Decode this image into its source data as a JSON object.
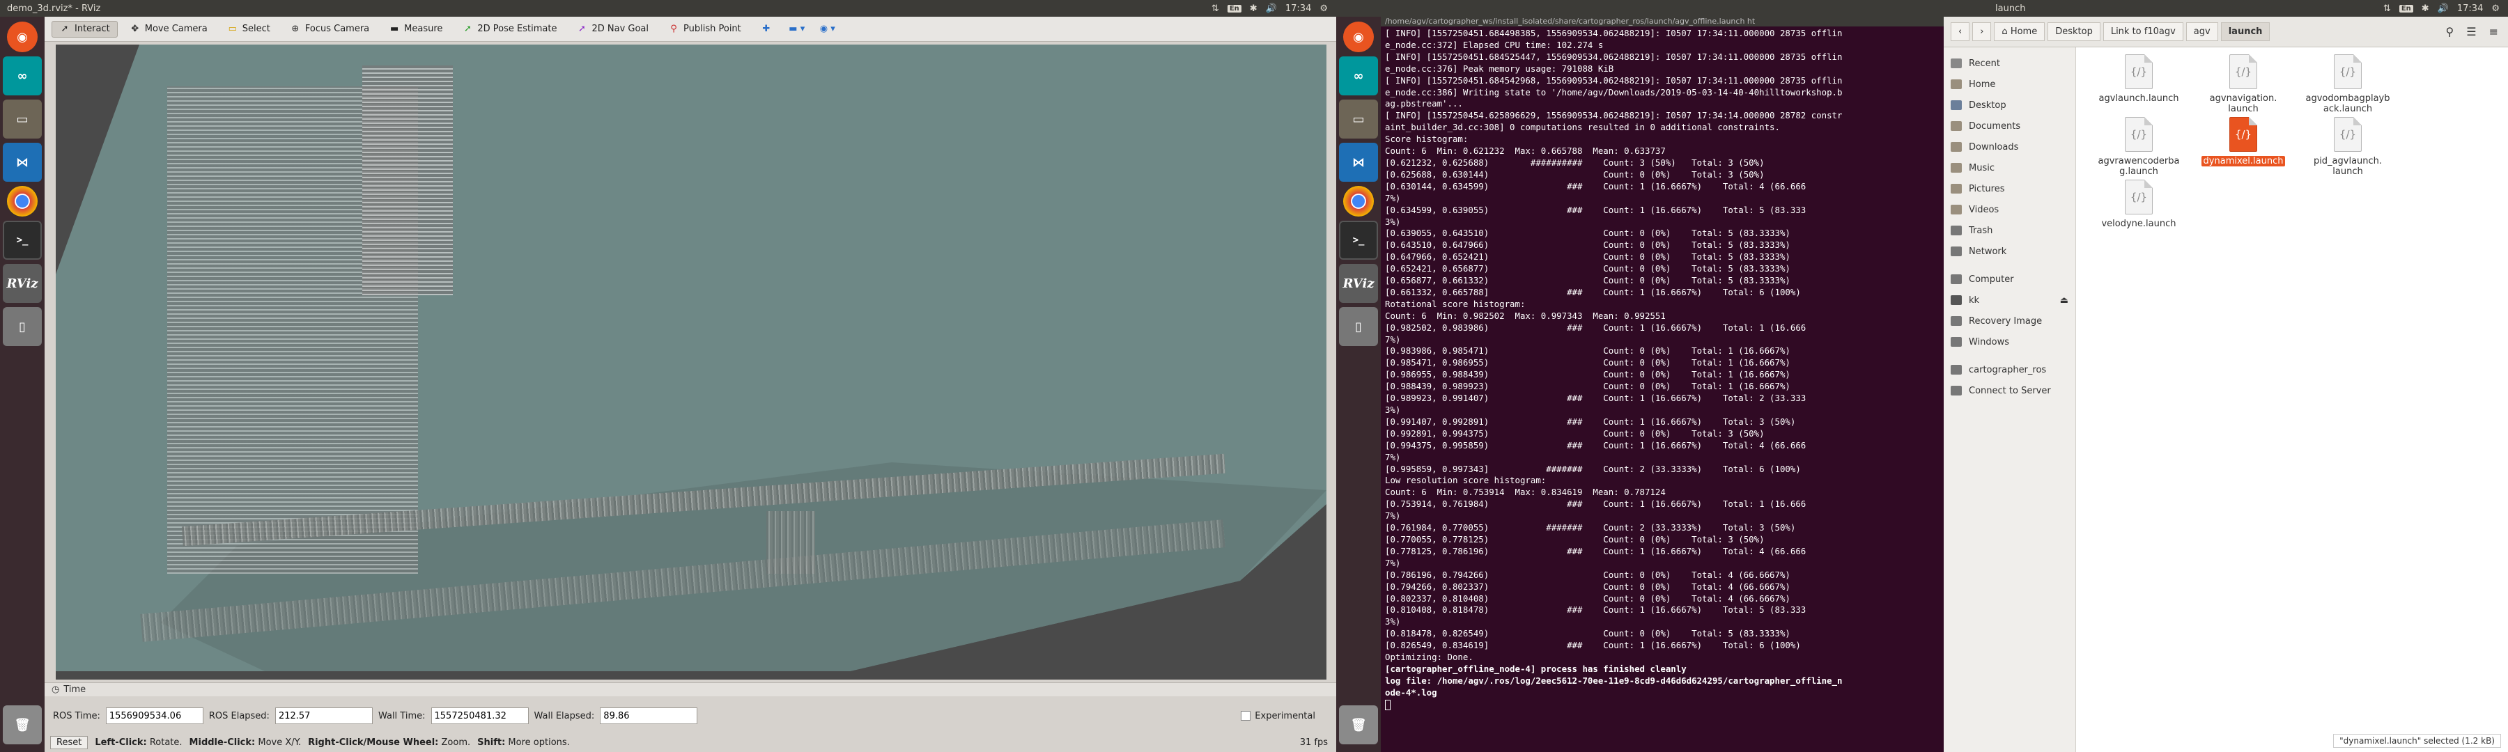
{
  "left_panel": {
    "title": "demo_3d.rviz* - RViz",
    "keyboard": "En",
    "time": "17:34"
  },
  "right_panel": {
    "title": "launch",
    "keyboard": "En",
    "time": "17:34"
  },
  "rviz": {
    "tools": [
      "Interact",
      "Move Camera",
      "Select",
      "Focus Camera",
      "Measure",
      "2D Pose Estimate",
      "2D Nav Goal",
      "Publish Point"
    ],
    "time_panel_title": "Time",
    "ros_time_label": "ROS Time:",
    "ros_time_value": "1556909534.06",
    "ros_elapsed_label": "ROS Elapsed:",
    "ros_elapsed_value": "212.57",
    "wall_time_label": "Wall Time:",
    "wall_time_value": "1557250481.32",
    "wall_elapsed_label": "Wall Elapsed:",
    "wall_elapsed_value": "89.86",
    "experimental_label": "Experimental",
    "reset_label": "Reset",
    "hint_left": "Left-Click:",
    "hint_left_text": "Rotate.",
    "hint_middle": "Middle-Click:",
    "hint_middle_text": "Move X/Y.",
    "hint_right": "Right-Click/Mouse Wheel:",
    "hint_right_text": "Zoom.",
    "hint_shift": "Shift:",
    "hint_shift_text": "More options.",
    "fps": "31 fps"
  },
  "terminal": {
    "title": "/home/agv/cartographer_ws/install_isolated/share/cartographer_ros/launch/agv_offline.launch ht",
    "lines": [
      "[ INFO] [1557250451.684498385, 1556909534.062488219]: I0507 17:34:11.000000 28735 offlin",
      "e_node.cc:372] Elapsed CPU time: 102.274 s",
      "[ INFO] [1557250451.684525447, 1556909534.062488219]: I0507 17:34:11.000000 28735 offlin",
      "e_node.cc:376] Peak memory usage: 791088 KiB",
      "[ INFO] [1557250451.684542968, 1556909534.062488219]: I0507 17:34:11.000000 28735 offlin",
      "e_node.cc:386] Writing state to '/home/agv/Downloads/2019-05-03-14-40-40hilltoworkshop.b",
      "ag.pbstream'...",
      "[ INFO] [1557250454.625896629, 1556909534.062488219]: I0507 17:34:14.000000 28782 constr",
      "aint_builder_3d.cc:308] 0 computations resulted in 0 additional constraints.",
      "Score histogram:",
      "Count: 6  Min: 0.621232  Max: 0.665788  Mean: 0.633737",
      "[0.621232, 0.625688)        ##########    Count: 3 (50%)   Total: 3 (50%)",
      "[0.625688, 0.630144)                      Count: 0 (0%)    Total: 3 (50%)",
      "[0.630144, 0.634599)               ###    Count: 1 (16.6667%)    Total: 4 (66.666",
      "7%)",
      "[0.634599, 0.639055)               ###    Count: 1 (16.6667%)    Total: 5 (83.333",
      "3%)",
      "[0.639055, 0.643510)                      Count: 0 (0%)    Total: 5 (83.3333%)",
      "[0.643510, 0.647966)                      Count: 0 (0%)    Total: 5 (83.3333%)",
      "[0.647966, 0.652421)                      Count: 0 (0%)    Total: 5 (83.3333%)",
      "[0.652421, 0.656877)                      Count: 0 (0%)    Total: 5 (83.3333%)",
      "[0.656877, 0.661332)                      Count: 0 (0%)    Total: 5 (83.3333%)",
      "[0.661332, 0.665788]               ###    Count: 1 (16.6667%)    Total: 6 (100%)",
      "Rotational score histogram:",
      "Count: 6  Min: 0.982502  Max: 0.997343  Mean: 0.992551",
      "[0.982502, 0.983986)               ###    Count: 1 (16.6667%)    Total: 1 (16.666",
      "7%)",
      "[0.983986, 0.985471)                      Count: 0 (0%)    Total: 1 (16.6667%)",
      "[0.985471, 0.986955)                      Count: 0 (0%)    Total: 1 (16.6667%)",
      "[0.986955, 0.988439)                      Count: 0 (0%)    Total: 1 (16.6667%)",
      "[0.988439, 0.989923)                      Count: 0 (0%)    Total: 1 (16.6667%)",
      "[0.989923, 0.991407)               ###    Count: 1 (16.6667%)    Total: 2 (33.333",
      "3%)",
      "[0.991407, 0.992891)               ###    Count: 1 (16.6667%)    Total: 3 (50%)",
      "[0.992891, 0.994375)                      Count: 0 (0%)    Total: 3 (50%)",
      "[0.994375, 0.995859)               ###    Count: 1 (16.6667%)    Total: 4 (66.666",
      "7%)",
      "[0.995859, 0.997343]           #######    Count: 2 (33.3333%)    Total: 6 (100%)",
      "Low resolution score histogram:",
      "Count: 6  Min: 0.753914  Max: 0.834619  Mean: 0.787124",
      "[0.753914, 0.761984)               ###    Count: 1 (16.6667%)    Total: 1 (16.666",
      "7%)",
      "[0.761984, 0.770055)           #######    Count: 2 (33.3333%)    Total: 3 (50%)",
      "[0.770055, 0.778125)                      Count: 0 (0%)    Total: 3 (50%)",
      "[0.778125, 0.786196)               ###    Count: 1 (16.6667%)    Total: 4 (66.666",
      "7%)",
      "[0.786196, 0.794266)                      Count: 0 (0%)    Total: 4 (66.6667%)",
      "[0.794266, 0.802337)                      Count: 0 (0%)    Total: 4 (66.6667%)",
      "[0.802337, 0.810408)                      Count: 0 (0%)    Total: 4 (66.6667%)",
      "[0.810408, 0.818478)               ###    Count: 1 (16.6667%)    Total: 5 (83.333",
      "3%)",
      "[0.818478, 0.826549)                      Count: 0 (0%)    Total: 5 (83.3333%)",
      "[0.826549, 0.834619]               ###    Count: 1 (16.6667%)    Total: 6 (100%)",
      "Optimizing: Done."
    ],
    "bold_lines": [
      "[cartographer_offline_node-4] process has finished cleanly",
      "log file: /home/agv/.ros/log/2eec5612-70ee-11e9-8cd9-d46d6d624295/cartographer_offline_n",
      "ode-4*.log"
    ]
  },
  "files": {
    "breadcrumbs": [
      "Home",
      "Desktop",
      "Link to f10agv",
      "agv",
      "launch"
    ],
    "sidebar": [
      "Recent",
      "Home",
      "Desktop",
      "Documents",
      "Downloads",
      "Music",
      "Pictures",
      "Videos",
      "Trash",
      "Network",
      "Computer",
      "kk",
      "Recovery Image",
      "Windows",
      "cartographer_ros",
      "Connect to Server"
    ],
    "items": [
      "agvlaunch.launch",
      "agvnavigation.\nlaunch",
      "agvodombagplayb\nack.launch",
      "agvrawencoderba\ng.launch",
      "dynamixel.launch",
      "pid_agvlaunch.\nlaunch",
      "velodyne.launch"
    ],
    "status": "\"dynamixel.launch\" selected  (1.2 kB)"
  },
  "colors": {
    "terminal_bg": "#300a24",
    "selection": "#e95420",
    "map_floor": "#6e8886"
  }
}
